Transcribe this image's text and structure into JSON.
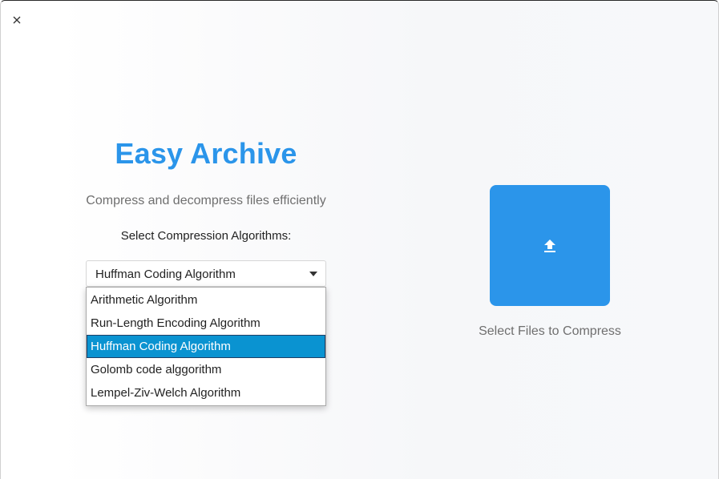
{
  "window": {
    "close_icon": "close-icon"
  },
  "header": {
    "title": "Easy Archive",
    "subtitle": "Compress and decompress files efficiently"
  },
  "algorithm_select": {
    "label": "Select Compression Algorithms:",
    "selected_value": "Huffman Coding Algorithm",
    "options": [
      "Arithmetic Algorithm",
      "Run-Length Encoding Algorithm",
      "Huffman Coding Algorithm",
      "Golomb code alggorithm",
      "Lempel-Ziv-Welch Algorithm"
    ],
    "highlighted_index": 2
  },
  "upload": {
    "icon": "upload-icon",
    "label": "Select Files to Compress"
  },
  "colors": {
    "accent": "#2b95ea",
    "option_highlight": "#0a93d1",
    "muted_text": "#6f6f6f"
  }
}
